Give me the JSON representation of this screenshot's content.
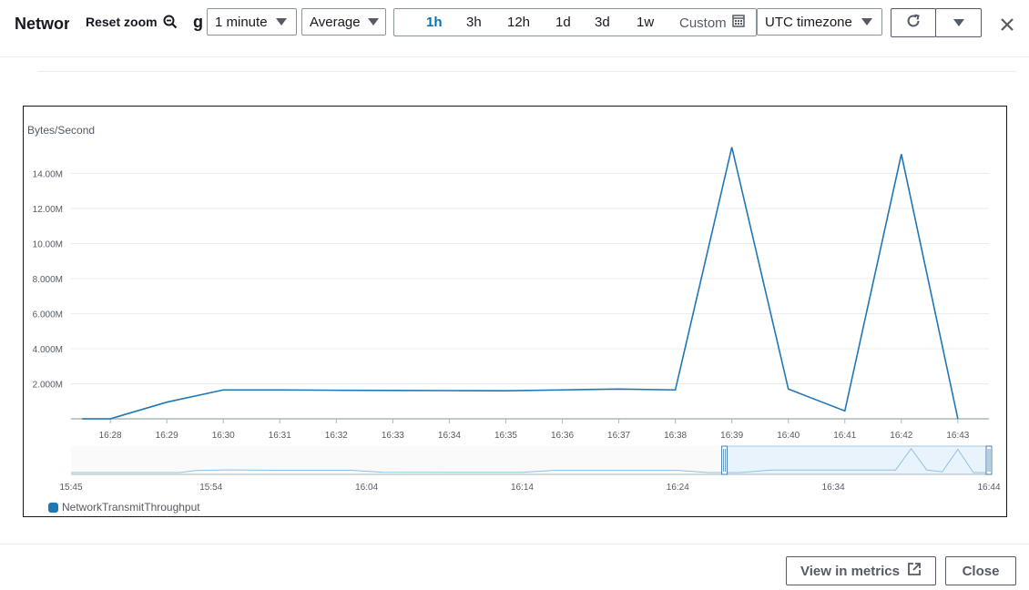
{
  "header": {
    "title": "Network Transmit Throughput",
    "title_tail": "g",
    "reset_zoom_label": "Reset zoom",
    "period_select": "1 minute",
    "statistic_select": "Average",
    "time_ranges": [
      "1h",
      "3h",
      "12h",
      "1d",
      "3d",
      "1w"
    ],
    "active_range": "1h",
    "custom_label": "Custom",
    "timezone_select": "UTC timezone"
  },
  "icons": {
    "reset_zoom": "zoom-out-icon",
    "custom": "calendar-icon",
    "refresh": "refresh-icon",
    "more": "caret-down-icon",
    "close": "close-icon",
    "external": "external-link-icon"
  },
  "colors": {
    "series": "#1f77b4",
    "active_range": "#0073bb",
    "navigator_fill": "#e9f3fb"
  },
  "chart_data": {
    "type": "line",
    "ylabel": "Bytes/Second",
    "y_ticks": [
      "2.000M",
      "4.000M",
      "6.000M",
      "8.000M",
      "10.00M",
      "12.00M",
      "14.00M"
    ],
    "ylim": [
      0,
      16000000
    ],
    "x_ticks": [
      "16:28",
      "16:29",
      "16:30",
      "16:31",
      "16:32",
      "16:33",
      "16:34",
      "16:35",
      "16:36",
      "16:37",
      "16:38",
      "16:39",
      "16:40",
      "16:41",
      "16:42",
      "16:43"
    ],
    "series": [
      {
        "name": "NetworkTransmitThroughput",
        "x": [
          "16:27.5",
          "16:28",
          "16:29",
          "16:30",
          "16:31",
          "16:32",
          "16:33",
          "16:34",
          "16:35",
          "16:36",
          "16:37",
          "16:38",
          "16:39",
          "16:40",
          "16:41",
          "16:42",
          "16:43"
        ],
        "values": [
          0,
          0,
          950000,
          1650000,
          1650000,
          1630000,
          1620000,
          1610000,
          1600000,
          1650000,
          1700000,
          1650000,
          15500000,
          1700000,
          450000,
          15100000,
          0
        ]
      }
    ],
    "grid": true,
    "legend": "bottom-left",
    "navigator": {
      "x_ticks": [
        "15:45",
        "15:54",
        "16:04",
        "16:14",
        "16:24",
        "16:34",
        "16:44"
      ],
      "selected_range": [
        "16:27",
        "16:44"
      ]
    }
  },
  "footer": {
    "view_in_metrics_label": "View in metrics",
    "close_label": "Close"
  }
}
